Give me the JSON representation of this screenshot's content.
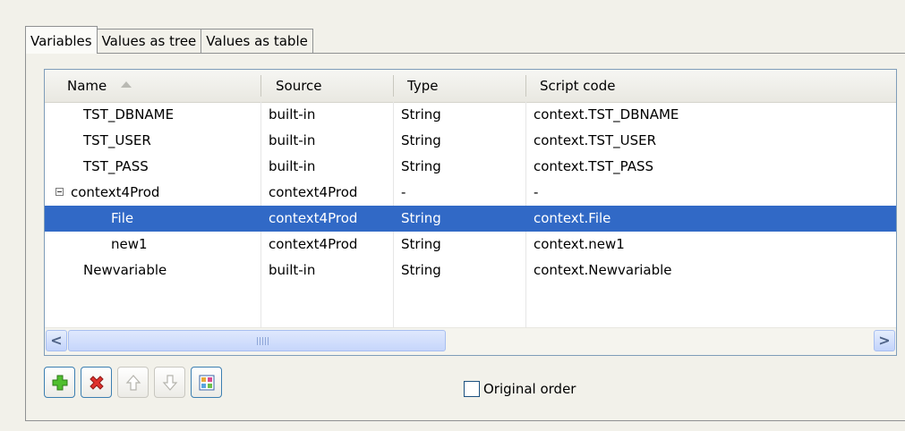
{
  "tabs": [
    "Variables",
    "Values as tree",
    "Values as table"
  ],
  "table": {
    "columns": [
      "Name",
      "Source",
      "Type",
      "Script code"
    ],
    "rows": [
      {
        "name": "TST_DBNAME",
        "source": "built-in",
        "type": "String",
        "script": "context.TST_DBNAME"
      },
      {
        "name": "TST_USER",
        "source": "built-in",
        "type": "String",
        "script": "context.TST_USER"
      },
      {
        "name": "TST_PASS",
        "source": "built-in",
        "type": "String",
        "script": "context.TST_PASS"
      },
      {
        "name": "context4Prod",
        "source": "context4Prod",
        "type": "-",
        "script": "-"
      },
      {
        "name": "File",
        "source": "context4Prod",
        "type": "String",
        "script": "context.File"
      },
      {
        "name": "new1",
        "source": "context4Prod",
        "type": "String",
        "script": "context.new1"
      },
      {
        "name": "Newvariable",
        "source": "built-in",
        "type": "String",
        "script": "context.Newvariable"
      }
    ]
  },
  "scrollbar": {
    "left_arrow": "<",
    "right_arrow": ">"
  },
  "toolbar": {
    "buttons": [
      "add-icon",
      "delete-icon",
      "move-up-icon",
      "move-down-icon",
      "context-icon"
    ]
  },
  "original_order": {
    "label": "Original order",
    "checked": false
  },
  "colors": {
    "selection": "#3169c6",
    "accent": "#3c7fb1"
  }
}
